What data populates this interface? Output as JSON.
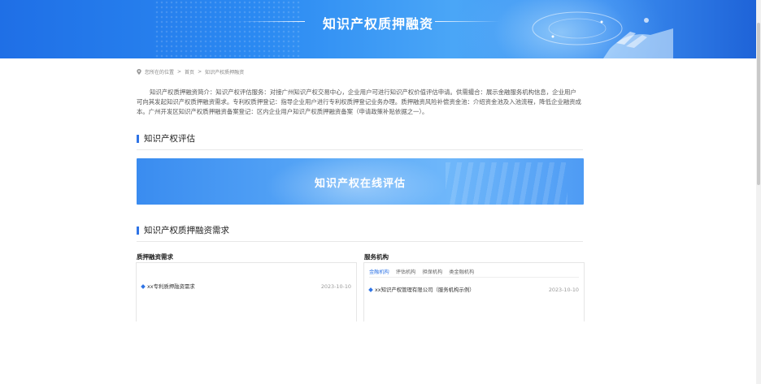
{
  "banner": {
    "title": "知识产权质押融资"
  },
  "breadcrumb": {
    "prefix": "您所在的位置",
    "sep": ">",
    "home": "首页",
    "current": "知识产权质押融资"
  },
  "intro": "知识产权质押融资简介：知识产权评估服务：对接广州知识产权交易中心，企业用户可进行知识产权价值评估申请。供需撮合：展示金融服务机构信息，企业用户可向其发起知识产权质押融资需求。专利权质押登记：指导企业用户进行专利权质押登记业务办理。质押融资风险补偿资金池：介绍资金池及入池流程，降低企业融资成本。广州开发区知识产权质押融资备案登记：区内企业用户知识产权质押融资备案（申请政策补贴依据之一）。",
  "sections": {
    "evaluation": {
      "title": "知识产权评估",
      "banner_label": "知识产权在线评估"
    },
    "demand": {
      "title": "知识产权质押融资需求"
    }
  },
  "pledge_demand": {
    "title": "质押融资需求",
    "items": [
      {
        "name": "xx专利质押融资需求",
        "date": "2023-10-10"
      }
    ]
  },
  "service_orgs": {
    "title": "服务机构",
    "tabs": [
      "金融机构",
      "评估机构",
      "担保机构",
      "类金融机构"
    ],
    "active_tab": 0,
    "items": [
      {
        "name": "xx知识产权管理有限公司（服务机构示例）",
        "date": "2023-10-10"
      }
    ]
  },
  "colors": {
    "accent": "#2f74e6",
    "banner_start": "#1f6fe6",
    "banner_end": "#1e63d8"
  }
}
